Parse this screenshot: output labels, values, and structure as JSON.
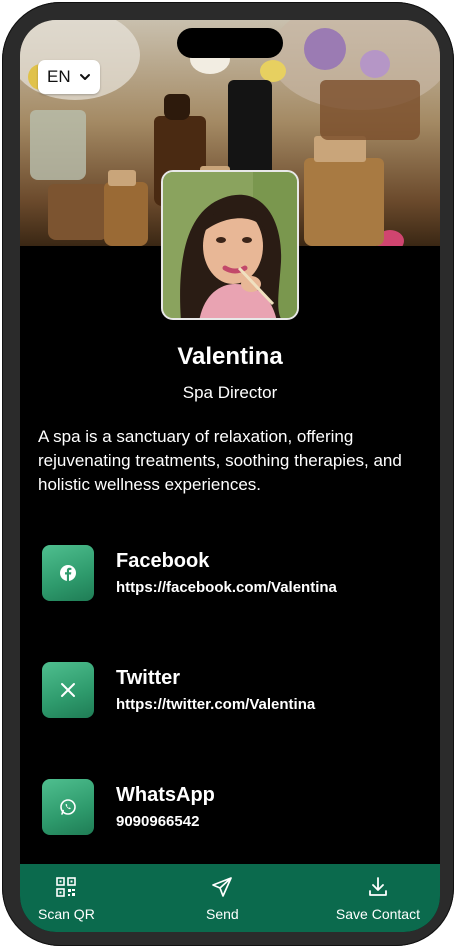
{
  "language": {
    "selected": "EN"
  },
  "profile": {
    "name": "Valentina",
    "title": "Spa Director",
    "bio": "A spa is a sanctuary of relaxation, offering rejuvenating treatments, soothing therapies, and holistic wellness experiences."
  },
  "social": [
    {
      "label": "Facebook",
      "value": "https://facebook.com/Valentina",
      "icon": "facebook-icon"
    },
    {
      "label": "Twitter",
      "value": "https://twitter.com/Valentina",
      "icon": "x-icon"
    },
    {
      "label": "WhatsApp",
      "value": "9090966542",
      "icon": "whatsapp-icon"
    }
  ],
  "nav": {
    "scan": "Scan QR",
    "send": "Send",
    "save": "Save Contact"
  },
  "colors": {
    "accent": "#0b6a4d",
    "tile": "#2e9a6c",
    "background": "#000000"
  }
}
